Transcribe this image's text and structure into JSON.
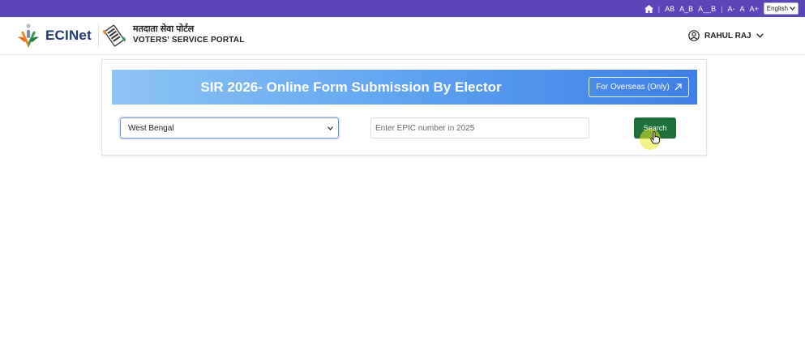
{
  "topbar": {
    "home_icon": "home-icon",
    "text_sizes": [
      "AB",
      "A_B",
      "A__B"
    ],
    "font_sizes": [
      "A-",
      "A",
      "A+"
    ],
    "language": "English",
    "bg_color": "#5b45b8"
  },
  "header": {
    "brand": "ECINet",
    "portal_hindi": "मतदाता सेवा पोर्टल",
    "portal_english": "VOTERS' SERVICE PORTAL",
    "user_name": "RAHUL RAJ"
  },
  "main": {
    "banner_title": "SIR 2026- Online Form Submission By Elector",
    "overseas_label": "For Overseas (Only)",
    "state_selected": "West Bengal",
    "epic_placeholder": "Enter EPIC number in 2025",
    "search_label": "Search"
  },
  "colors": {
    "accent": "#5b45b8",
    "banner": "#5b9ff0",
    "search": "#1f6f3a"
  }
}
